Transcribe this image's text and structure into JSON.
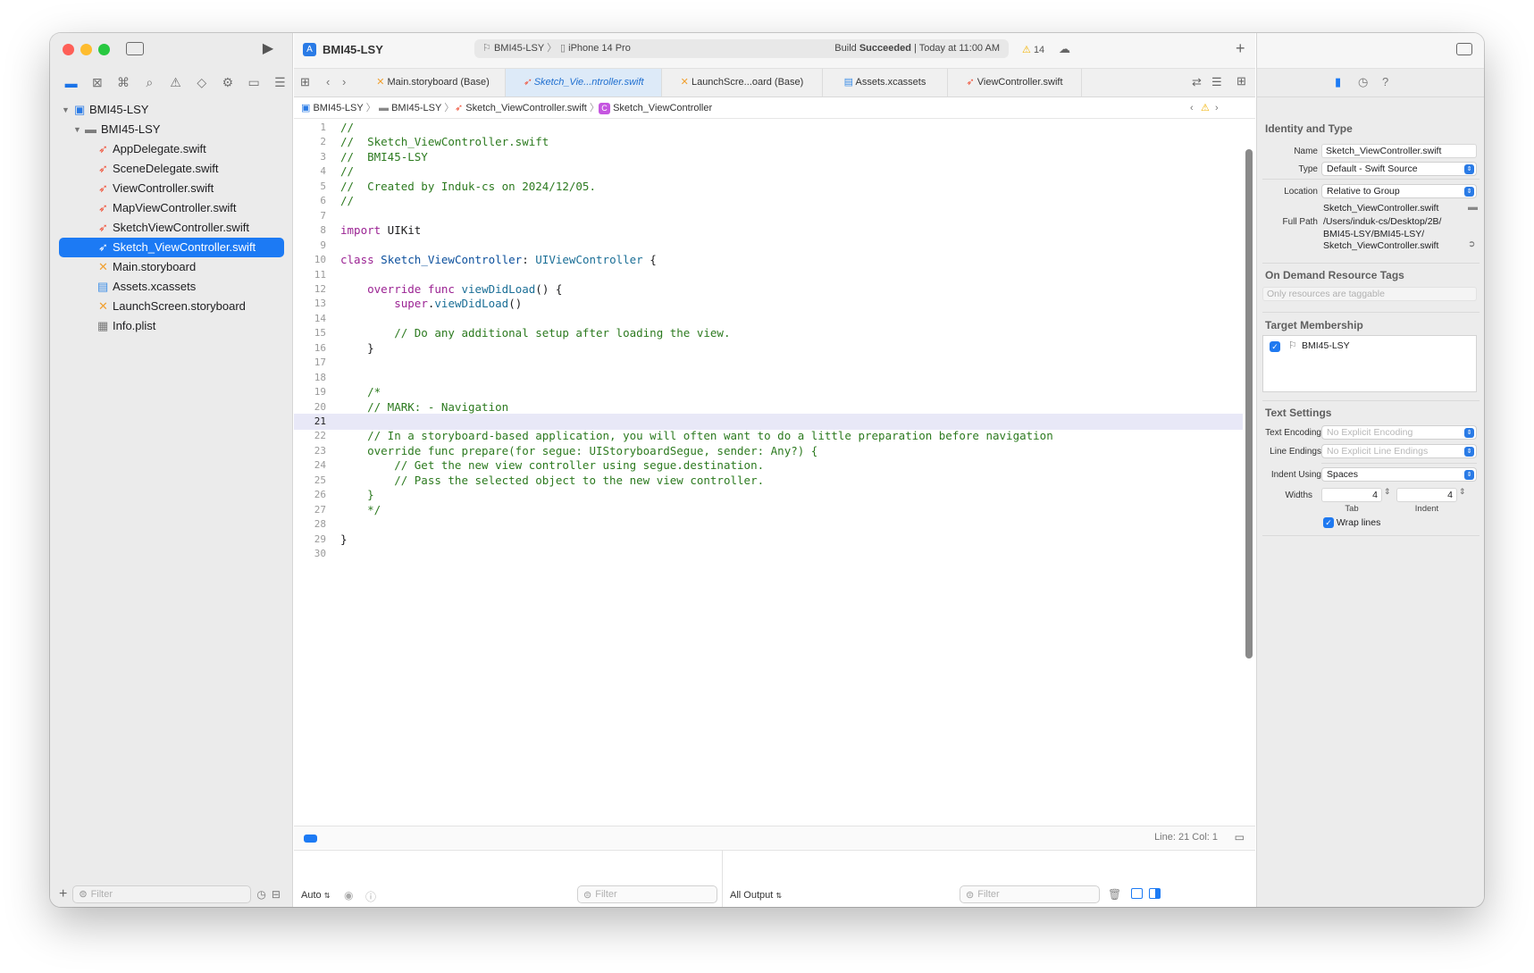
{
  "toolbar": {
    "project_name": "BMI45-LSY",
    "scheme": "BMI45-LSY",
    "destination": "iPhone 14 Pro",
    "build_status_prefix": "Build",
    "build_status_word": "Succeeded",
    "build_status_time": "| Today at 11:00 AM",
    "warning_count": "14"
  },
  "navigator": {
    "items": [
      {
        "label": "BMI45-LSY",
        "kind": "project",
        "level": 0
      },
      {
        "label": "BMI45-LSY",
        "kind": "folder",
        "level": 1
      },
      {
        "label": "AppDelegate.swift",
        "kind": "swift",
        "level": 2
      },
      {
        "label": "SceneDelegate.swift",
        "kind": "swift",
        "level": 2
      },
      {
        "label": "ViewController.swift",
        "kind": "swift",
        "level": 2
      },
      {
        "label": "MapViewController.swift",
        "kind": "swift",
        "level": 2
      },
      {
        "label": "SketchViewController.swift",
        "kind": "swift",
        "level": 2
      },
      {
        "label": "Sketch_ViewController.swift",
        "kind": "swift",
        "level": 2,
        "selected": true
      },
      {
        "label": "Main.storyboard",
        "kind": "storyboard",
        "level": 2
      },
      {
        "label": "Assets.xcassets",
        "kind": "assets",
        "level": 2
      },
      {
        "label": "LaunchScreen.storyboard",
        "kind": "storyboard",
        "level": 2
      },
      {
        "label": "Info.plist",
        "kind": "plist",
        "level": 2
      }
    ],
    "filter_placeholder": "Filter"
  },
  "tabs": [
    {
      "label": "Main.storyboard (Base)",
      "icon": "storyboard"
    },
    {
      "label": "Sketch_Vie...ntroller.swift",
      "icon": "swift",
      "active": true
    },
    {
      "label": "LaunchScre...oard (Base)",
      "icon": "storyboard"
    },
    {
      "label": "Assets.xcassets",
      "icon": "assets"
    },
    {
      "label": "ViewController.swift",
      "icon": "swift"
    }
  ],
  "jumpbar": {
    "project": "BMI45-LSY",
    "group": "BMI45-LSY",
    "file": "Sketch_ViewController.swift",
    "symbol": "Sketch_ViewController"
  },
  "code_lines": [
    "//",
    "//  Sketch_ViewController.swift",
    "//  BMI45-LSY",
    "//",
    "//  Created by Induk-cs on 2024/12/05.",
    "//",
    "",
    "import UIKit",
    "",
    "class Sketch_ViewController: UIViewController {",
    "",
    "    override func viewDidLoad() {",
    "        super.viewDidLoad()",
    "",
    "        // Do any additional setup after loading the view.",
    "    }",
    "",
    "",
    "    /*",
    "    // MARK: - Navigation",
    "",
    "    // In a storyboard-based application, you will often want to do a little preparation before navigation",
    "    override func prepare(for segue: UIStoryboardSegue, sender: Any?) {",
    "        // Get the new view controller using segue.destination.",
    "        // Pass the selected object to the new view controller.",
    "    }",
    "    */",
    "",
    "}",
    ""
  ],
  "current_line": 21,
  "status": {
    "line_col": "Line: 21  Col: 1"
  },
  "console": {
    "left_mode": "Auto",
    "right_mode": "All Output",
    "filter_placeholder": "Filter"
  },
  "inspector": {
    "identity_header": "Identity and Type",
    "name_label": "Name",
    "name_value": "Sketch_ViewController.swift",
    "type_label": "Type",
    "type_value": "Default - Swift Source",
    "location_label": "Location",
    "location_value": "Relative to Group",
    "location_file": "Sketch_ViewController.swift",
    "full_path_label": "Full Path",
    "full_path_1": "/Users/induk-cs/Desktop/2B/",
    "full_path_2": "BMI45-LSY/BMI45-LSY/",
    "full_path_3": "Sketch_ViewController.swift",
    "odr_header": "On Demand Resource Tags",
    "odr_placeholder": "Only resources are taggable",
    "target_header": "Target Membership",
    "target_item": "BMI45-LSY",
    "text_header": "Text Settings",
    "encoding_label": "Text Encoding",
    "encoding_value": "No Explicit Encoding",
    "line_endings_label": "Line Endings",
    "line_endings_value": "No Explicit Line Endings",
    "indent_label": "Indent Using",
    "indent_value": "Spaces",
    "widths_label": "Widths",
    "tab_value": "4",
    "indent_width_value": "4",
    "tab_caption": "Tab",
    "indent_caption": "Indent",
    "wrap_label": "Wrap lines"
  },
  "colors": {
    "accent": "#1c7af4",
    "swift": "#f05138",
    "warning": "#f2b200",
    "comment": "#2c7a1f",
    "keyword": "#9b2393"
  }
}
